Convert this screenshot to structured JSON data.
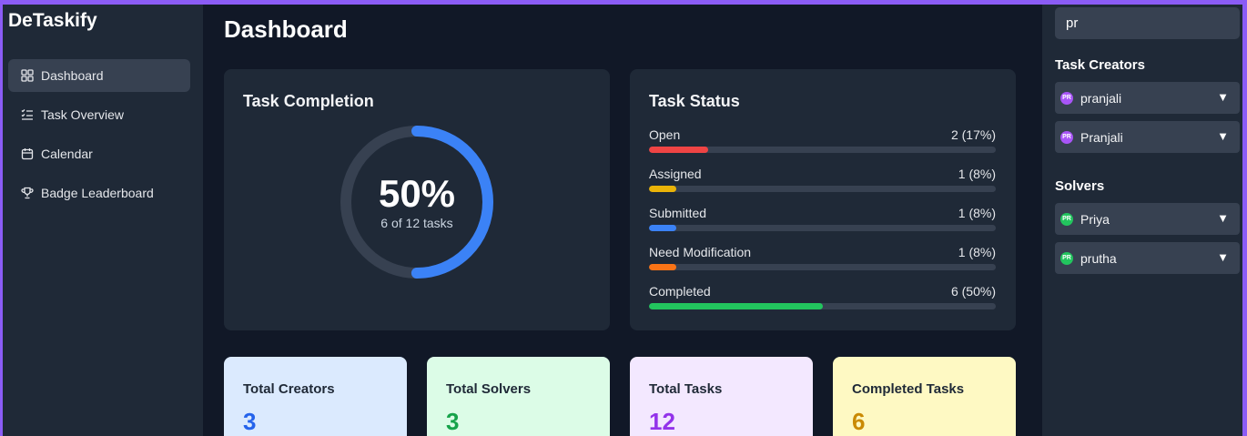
{
  "app": {
    "brand": "DeTaskify"
  },
  "sidebar": {
    "items": [
      {
        "label": "Dashboard",
        "icon": "grid-icon",
        "active": true
      },
      {
        "label": "Task Overview",
        "icon": "list-icon",
        "active": false
      },
      {
        "label": "Calendar",
        "icon": "calendar-icon",
        "active": false
      },
      {
        "label": "Badge Leaderboard",
        "icon": "trophy-icon",
        "active": false
      }
    ]
  },
  "main": {
    "title": "Dashboard",
    "completion": {
      "title": "Task Completion",
      "percent_label": "50%",
      "subtitle": "6 of 12 tasks",
      "fraction": 0.5,
      "accent": "#3b82f6"
    },
    "status": {
      "title": "Task Status",
      "rows": [
        {
          "label": "Open",
          "value": "2 (17%)",
          "fraction": 0.17,
          "color": "#ef4444"
        },
        {
          "label": "Assigned",
          "value": "1 (8%)",
          "fraction": 0.08,
          "color": "#eab308"
        },
        {
          "label": "Submitted",
          "value": "1 (8%)",
          "fraction": 0.08,
          "color": "#3b82f6"
        },
        {
          "label": "Need Modification",
          "value": "1 (8%)",
          "fraction": 0.08,
          "color": "#f97316"
        },
        {
          "label": "Completed",
          "value": "6 (50%)",
          "fraction": 0.5,
          "color": "#22c55e"
        }
      ]
    },
    "stats": [
      {
        "label": "Total Creators",
        "value": "3",
        "bg": "#dbeafe",
        "color": "#2563eb"
      },
      {
        "label": "Total Solvers",
        "value": "3",
        "bg": "#dcfce7",
        "color": "#16a34a"
      },
      {
        "label": "Total Tasks",
        "value": "12",
        "bg": "#f3e8ff",
        "color": "#9333ea"
      },
      {
        "label": "Completed Tasks",
        "value": "6",
        "bg": "#fef9c3",
        "color": "#ca8a04"
      }
    ]
  },
  "right_panel": {
    "search": {
      "value": "pr",
      "placeholder": ""
    },
    "creators": {
      "title": "Task Creators",
      "items": [
        {
          "name": "pranjali",
          "initials": "PR",
          "color": "#a855f7"
        },
        {
          "name": "Pranjali",
          "initials": "PR",
          "color": "#a855f7"
        }
      ]
    },
    "solvers": {
      "title": "Solvers",
      "items": [
        {
          "name": "Priya",
          "initials": "PR",
          "color": "#22c55e"
        },
        {
          "name": "prutha",
          "initials": "PR",
          "color": "#22c55e"
        }
      ]
    },
    "caret": "▼"
  }
}
